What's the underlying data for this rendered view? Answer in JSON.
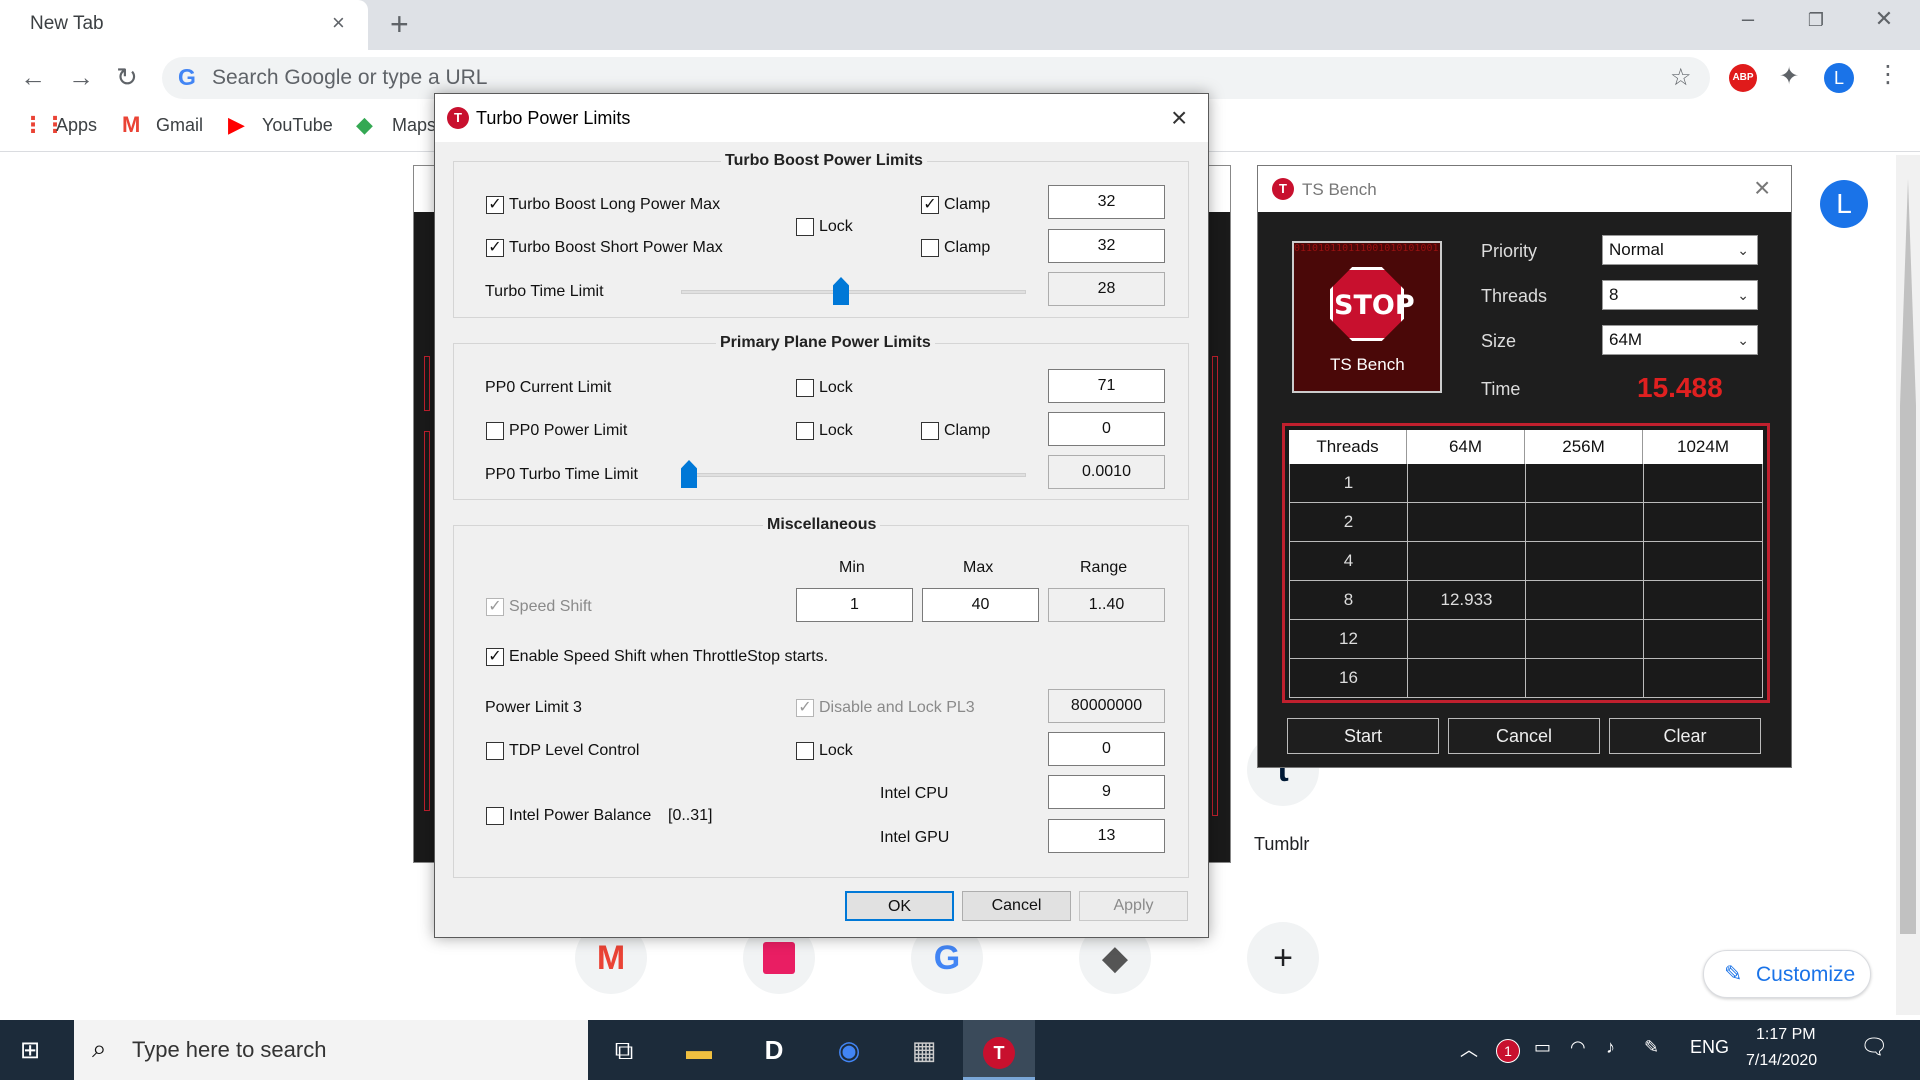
{
  "chrome": {
    "tab_title": "New Tab",
    "tab_close": "×",
    "new_tab": "+",
    "omnibox_placeholder": "Search Google or type a URL",
    "abp": "ABP",
    "profile_initial": "L",
    "bookmarks": [
      {
        "label": "Apps"
      },
      {
        "label": "Gmail"
      },
      {
        "label": "YouTube"
      },
      {
        "label": "Maps"
      }
    ]
  },
  "newtab_page": {
    "avatar_initial": "L",
    "shortcut_label": "Tumblr",
    "customize_label": "Customize"
  },
  "dialog": {
    "title": "Turbo Power Limits",
    "groups": {
      "turbo_boost": "Turbo Boost Power Limits",
      "primary_plane": "Primary Plane Power Limits",
      "misc": "Miscellaneous"
    },
    "turbo_long": {
      "label": "Turbo Boost Long Power Max",
      "checked": true,
      "clamp_label": "Clamp",
      "clamp_checked": true,
      "value": "32"
    },
    "turbo_short": {
      "label": "Turbo Boost Short Power Max",
      "checked": true,
      "clamp_label": "Clamp",
      "clamp_checked": false,
      "value": "32"
    },
    "turbo_lock": {
      "label": "Lock",
      "checked": false
    },
    "turbo_time": {
      "label": "Turbo Time Limit",
      "value": "28",
      "slider_fraction": 0.46
    },
    "pp0_current": {
      "label": "PP0 Current Limit",
      "lock_label": "Lock",
      "value": "71"
    },
    "pp0_power": {
      "label": "PP0 Power Limit",
      "lock_label": "Lock",
      "clamp_label": "Clamp",
      "value": "0"
    },
    "pp0_time": {
      "label": "PP0 Turbo Time Limit",
      "value": "0.0010",
      "slider_fraction": 0.0
    },
    "misc": {
      "col_min": "Min",
      "col_max": "Max",
      "col_range": "Range",
      "speed_shift_label": "Speed Shift",
      "speed_shift_min": "1",
      "speed_shift_max": "40",
      "speed_shift_range": "1..40",
      "enable_ss_label": "Enable Speed Shift when ThrottleStop starts.",
      "pl3_label": "Power Limit 3",
      "disable_pl3_label": "Disable and Lock PL3",
      "pl3_value": "80000000",
      "tdp_label": "TDP Level Control",
      "tdp_lock_label": "Lock",
      "tdp_value": "0",
      "ipb_label": "Intel Power Balance",
      "ipb_range": "[0..31]",
      "cpu_label": "Intel CPU",
      "cpu_value": "9",
      "gpu_label": "Intel GPU",
      "gpu_value": "13"
    },
    "buttons": {
      "ok": "OK",
      "cancel": "Cancel",
      "apply": "Apply"
    }
  },
  "bench": {
    "title": "TS Bench",
    "logo_stop": "STOP",
    "logo_caption": "TS Bench",
    "priority_label": "Priority",
    "priority_value": "Normal",
    "threads_label": "Threads",
    "threads_value": "8",
    "size_label": "Size",
    "size_value": "64M",
    "time_label": "Time",
    "time_value": "15.488",
    "table": {
      "headers": [
        "Threads",
        "64M",
        "256M",
        "1024M"
      ],
      "rows": [
        [
          "1",
          "",
          "",
          ""
        ],
        [
          "2",
          "",
          "",
          ""
        ],
        [
          "4",
          "",
          "",
          ""
        ],
        [
          "8",
          "12.933",
          "",
          ""
        ],
        [
          "12",
          "",
          "",
          ""
        ],
        [
          "16",
          "",
          "",
          ""
        ]
      ]
    },
    "buttons": {
      "start": "Start",
      "cancel": "Cancel",
      "clear": "Clear"
    }
  },
  "taskbar": {
    "search_placeholder": "Type here to search",
    "tray_badge": "1",
    "lang": "ENG",
    "time": "1:17 PM",
    "date": "7/14/2020"
  }
}
